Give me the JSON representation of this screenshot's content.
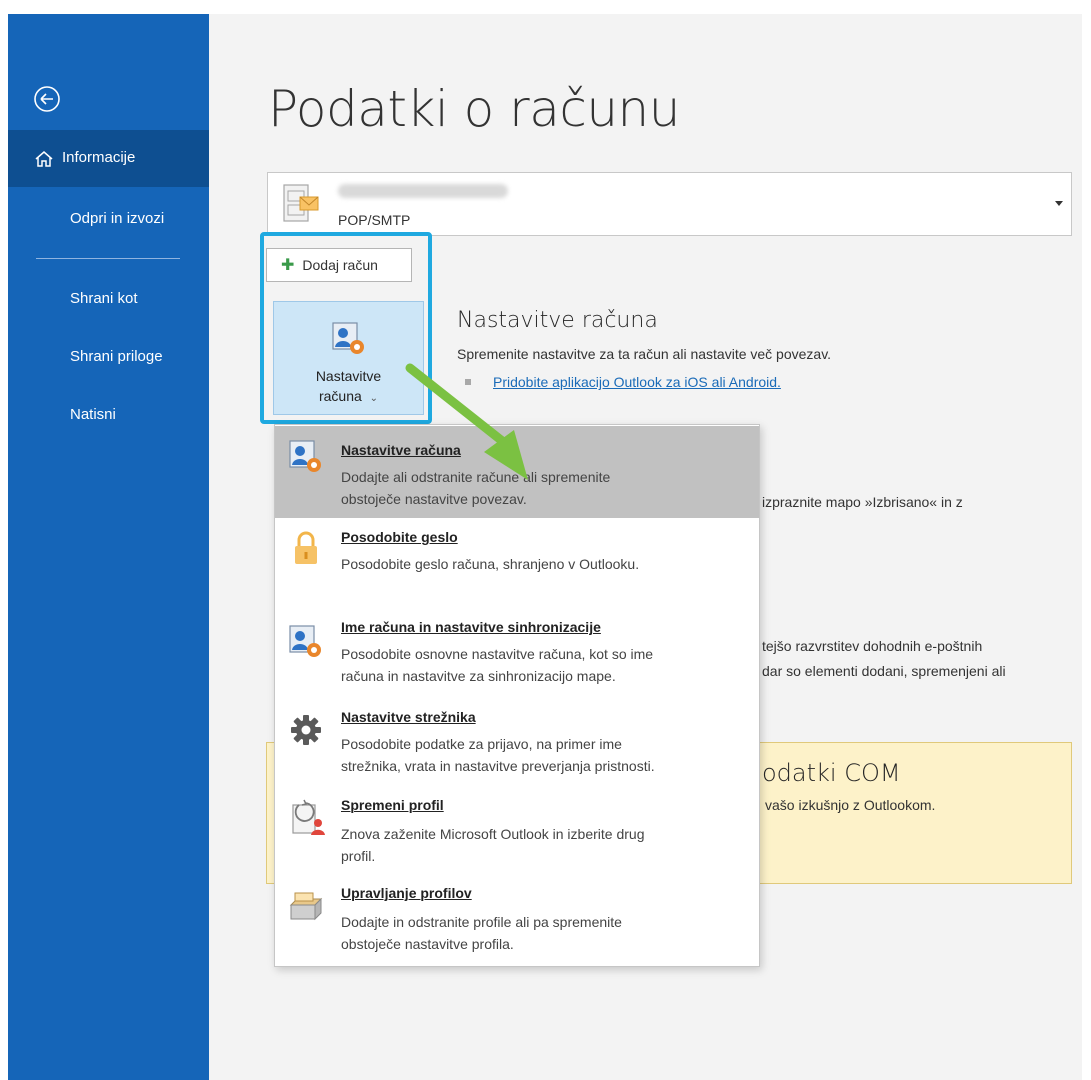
{
  "sidebar": {
    "items": [
      {
        "label": "Informacije",
        "active": true
      },
      {
        "label": "Odpri in izvozi"
      },
      {
        "label": "Shrani kot"
      },
      {
        "label": "Shrani priloge"
      },
      {
        "label": "Natisni"
      }
    ]
  },
  "main": {
    "title": "Podatki o računu",
    "account": {
      "type": "POP/SMTP"
    },
    "add_account_label": "Dodaj račun",
    "settings_tile": {
      "line1": "Nastavitve",
      "line2": "računa"
    },
    "account_settings": {
      "title": "Nastavitve računa",
      "desc": "Spremenite nastavitve za ta račun ali nastavite več povezav.",
      "link": "Pridobite aplikacijo Outlook za iOS ali Android."
    },
    "obscured": {
      "cleanup_text": "izpraznite mapo »Izbrisano« in z",
      "rules_line1": "tejšo razvrstitev dohodnih e-poštnih",
      "rules_line2": "dar so elementi dodani, spremenjeni ali",
      "com_title": "odatki COM",
      "com_desc": "vašo izkušnjo z Outlookom."
    }
  },
  "menu": {
    "items": [
      {
        "title": "Nastavitve računa",
        "desc1": "Dodajte ali odstranite račune ali spremenite",
        "desc2": "obstoječe nastavitve povezav.",
        "icon": "account-settings-icon"
      },
      {
        "title": "Posodobite geslo",
        "desc1": "Posodobite geslo računa, shranjeno v Outlooku.",
        "desc2": "",
        "icon": "lock-icon"
      },
      {
        "title": "Ime računa in nastavitve sinhronizacije",
        "desc1": "Posodobite osnovne nastavitve računa, kot so ime",
        "desc2": "računa in nastavitve za sinhronizacijo mape.",
        "icon": "account-sync-icon"
      },
      {
        "title": "Nastavitve strežnika",
        "desc1": "Posodobite podatke za prijavo, na primer ime",
        "desc2": "strežnika, vrata in nastavitve preverjanja pristnosti.",
        "icon": "gear-icon"
      },
      {
        "title": "Spremeni profil",
        "desc1": "Znova zaženite Microsoft Outlook in izberite drug",
        "desc2": "profil.",
        "icon": "change-profile-icon"
      },
      {
        "title": "Upravljanje profilov",
        "desc1": "Dodajte in odstranite profile ali pa spremenite",
        "desc2": "obstoječe nastavitve profila.",
        "icon": "manage-profiles-icon"
      }
    ]
  },
  "colors": {
    "sidebar": "#1565b8",
    "sidebar_active": "#0e4f91",
    "highlight": "#1fa9e0",
    "arrow": "#7bc142",
    "link": "#1a6bb8"
  }
}
